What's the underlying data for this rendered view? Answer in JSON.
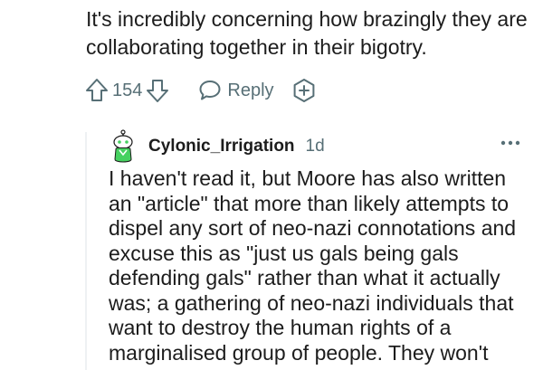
{
  "parent_comment": {
    "body": "It's incredibly concerning how brazingly they are collaborating together in their bigotry.",
    "score": "154",
    "reply_label": "Reply"
  },
  "reply_comment": {
    "username": "Cylonic_Irrigation",
    "timestamp": "1d",
    "body": "I haven't read it, but Moore has also written an \"article\" that more than likely attempts to dispel any sort of neo-nazi connotations and excuse this as \"just us gals being gals defending gals\" rather than what it actually was; a gathering of neo-nazi individuals that want to destroy the human rights of a marginalised group of people. They won't"
  },
  "icons": {
    "upvote": "arrow-up-icon",
    "downvote": "arrow-down-icon",
    "reply": "speech-bubble-icon",
    "award": "plus-award-icon",
    "more": "ellipsis-icon",
    "avatar": "snoo-avatar-icon"
  },
  "colors": {
    "text": "#1c1c1c",
    "meta": "#576f76",
    "thread_line": "#eef1f3",
    "avatar_green": "#46d160"
  }
}
